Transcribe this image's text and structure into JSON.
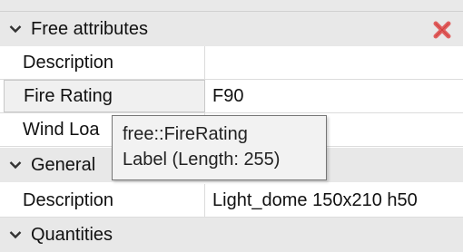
{
  "sections": {
    "free_attributes": {
      "title": "Free attributes",
      "rows": [
        {
          "label": "Description",
          "value": ""
        },
        {
          "label": "Fire Rating",
          "value": "F90"
        },
        {
          "label": "Wind Loa",
          "value": ""
        }
      ]
    },
    "general": {
      "title": "General",
      "rows": [
        {
          "label": "Description",
          "value": "Light_dome 150x210 h50"
        }
      ]
    },
    "quantities": {
      "title": "Quantities"
    }
  },
  "tooltip": {
    "line1": "free::FireRating",
    "line2": "Label (Length: 255)"
  },
  "colors": {
    "close_icon": "#d9534f",
    "header_bg": "#e8e8e8"
  },
  "icons": {
    "section_toggle": "chevron-down-icon",
    "close": "close-icon"
  }
}
